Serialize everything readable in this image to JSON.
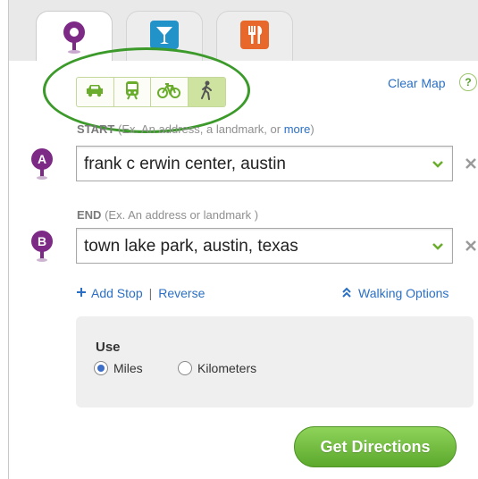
{
  "tabs": [
    {
      "name": "directions",
      "icon": "map-pin-icon",
      "color": "#7d2a86",
      "active": true
    },
    {
      "name": "bars",
      "icon": "cocktail-icon",
      "color": "#2293c9",
      "active": false
    },
    {
      "name": "restaurants",
      "icon": "fork-knife-icon",
      "color": "#e8682b",
      "active": false
    }
  ],
  "travel_modes": [
    {
      "mode": "drive",
      "icon": "car-icon",
      "active": false
    },
    {
      "mode": "transit",
      "icon": "train-icon",
      "active": false
    },
    {
      "mode": "bike",
      "icon": "bicycle-icon",
      "active": false
    },
    {
      "mode": "walk",
      "icon": "walking-person-icon",
      "active": true
    }
  ],
  "clear_map": "Clear Map",
  "help": "?",
  "start": {
    "label": "START",
    "hint_prefix": "(Ex. An address, a landmark, or",
    "hint_link": "more",
    "hint_suffix": ")",
    "marker": "A",
    "value": "frank c erwin center, austin"
  },
  "end": {
    "label": "END",
    "hint": "(Ex. An address or landmark )",
    "marker": "B",
    "value": "town lake park, austin, texas"
  },
  "links": {
    "add_stop": "Add Stop",
    "separator": "|",
    "reverse": "Reverse",
    "walking_options": "Walking Options"
  },
  "units": {
    "label": "Use",
    "options": [
      {
        "label": "Miles",
        "selected": true
      },
      {
        "label": "Kilometers",
        "selected": false
      }
    ]
  },
  "submit": "Get Directions",
  "colors": {
    "accent_green": "#5ba92c",
    "link_blue": "#2a6fc4",
    "marker_purple": "#7d2a86"
  }
}
